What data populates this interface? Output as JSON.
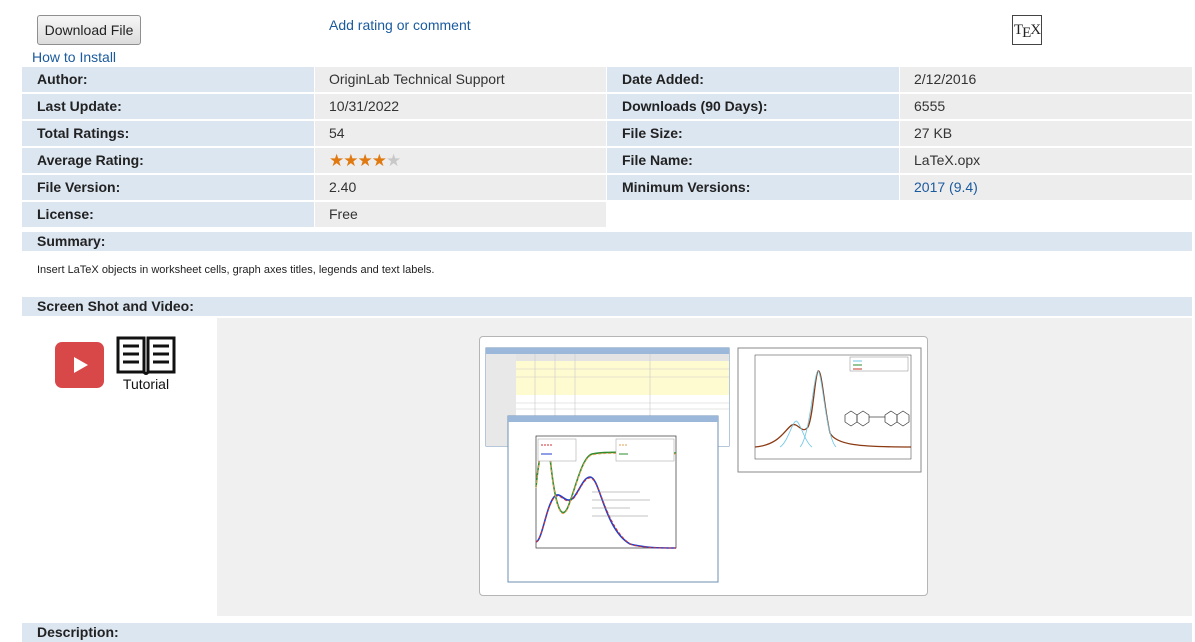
{
  "actions": {
    "download_label": "Download File",
    "how_to_install": "How to Install",
    "add_rating": "Add rating or comment",
    "tex_logo": "TEX"
  },
  "info": {
    "author": {
      "label": "Author:",
      "value": "OriginLab Technical Support"
    },
    "date_added": {
      "label": "Date Added:",
      "value": "2/12/2016"
    },
    "last_update": {
      "label": "Last Update:",
      "value": "10/31/2022"
    },
    "downloads": {
      "label": "Downloads (90 Days):",
      "value": "6555"
    },
    "total_ratings": {
      "label": "Total Ratings:",
      "value": "54"
    },
    "file_size": {
      "label": "File Size:",
      "value": "27 KB"
    },
    "average_rating": {
      "label": "Average Rating:",
      "value": 4,
      "max": 5
    },
    "file_name": {
      "label": "File Name:",
      "value": "LaTeX.opx"
    },
    "file_version": {
      "label": "File Version:",
      "value": "2.40"
    },
    "min_versions": {
      "label": "Minimum Versions:",
      "value": "2017 (9.4)"
    },
    "license": {
      "label": "License:",
      "value": "Free"
    }
  },
  "summary": {
    "heading": "Summary:",
    "text": "Insert LaTeX objects in worksheet cells, graph axes titles, legends and text labels."
  },
  "screenshot": {
    "heading": "Screen Shot and Video:",
    "tutorial_label": "Tutorial",
    "play_icon": "play-video-icon",
    "book_icon": "open-book-icon"
  },
  "description": {
    "heading": "Description:"
  },
  "colors": {
    "label_bg": "#dce6f1",
    "value_bg": "#ededed",
    "link": "#1a5a9e",
    "star": "#e07a10",
    "play": "#d94848"
  }
}
